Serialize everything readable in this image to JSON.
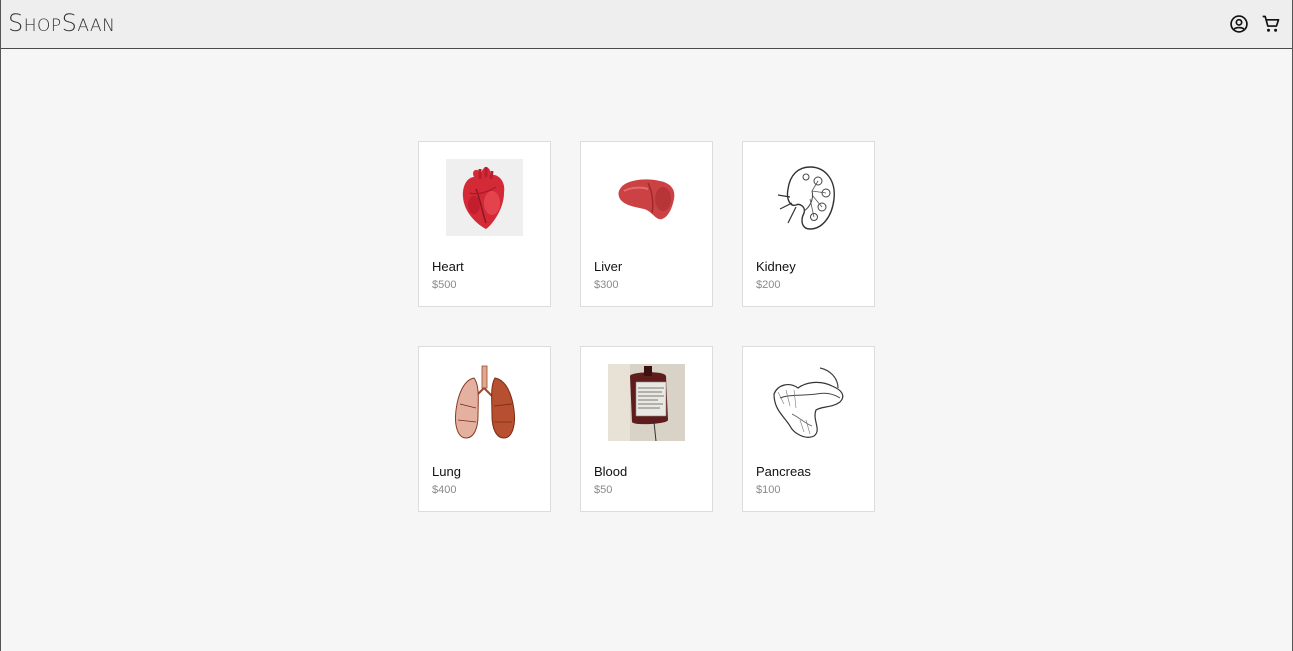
{
  "header": {
    "brand": "ShopSaan",
    "account_icon": "account-circle-icon",
    "cart_icon": "shopping-cart-icon"
  },
  "products": [
    {
      "name": "Heart",
      "price": "$500",
      "image": "heart-image"
    },
    {
      "name": "Liver",
      "price": "$300",
      "image": "liver-image"
    },
    {
      "name": "Kidney",
      "price": "$200",
      "image": "kidney-image"
    },
    {
      "name": "Lung",
      "price": "$400",
      "image": "lung-image"
    },
    {
      "name": "Blood",
      "price": "$50",
      "image": "blood-bag-image"
    },
    {
      "name": "Pancreas",
      "price": "$100",
      "image": "pancreas-image"
    }
  ]
}
